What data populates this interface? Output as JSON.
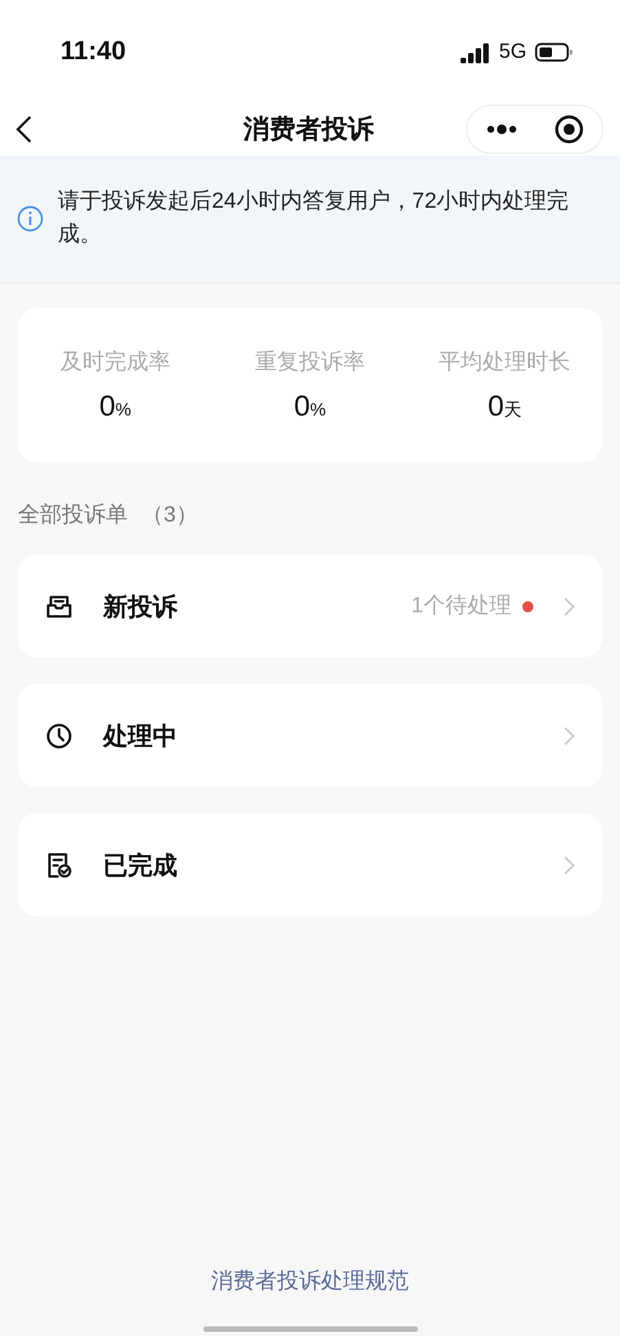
{
  "status_bar": {
    "time": "11:40",
    "network": "5G"
  },
  "nav": {
    "title": "消费者投诉"
  },
  "notice": {
    "text": "请于投诉发起后24小时内答复用户，72小时内处理完成。"
  },
  "stats": [
    {
      "label": "及时完成率",
      "value": "0",
      "unit": "%"
    },
    {
      "label": "重复投诉率",
      "value": "0",
      "unit": "%"
    },
    {
      "label": "平均处理时长",
      "value": "0",
      "unit": "天"
    }
  ],
  "section": {
    "title": "全部投诉单",
    "count": "（3）"
  },
  "rows": [
    {
      "kind": "inbox",
      "label": "新投诉",
      "pending": "1个待处理",
      "dot": true
    },
    {
      "kind": "clock",
      "label": "处理中",
      "dot": false
    },
    {
      "kind": "done",
      "label": "已完成",
      "dot": false
    }
  ],
  "footer": {
    "link": "消费者投诉处理规范"
  }
}
